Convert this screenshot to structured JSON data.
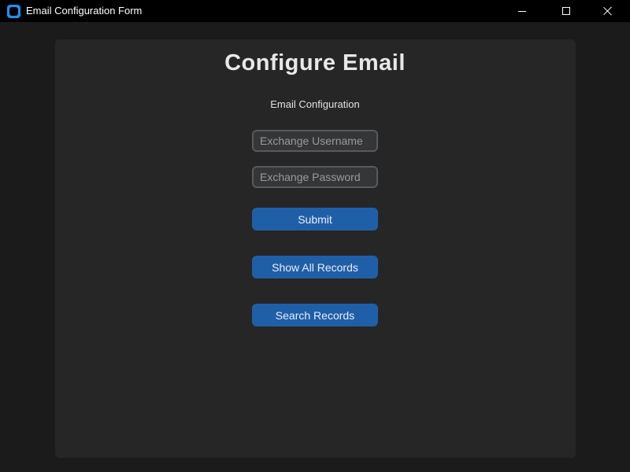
{
  "window": {
    "title": "Email Configuration Form",
    "controls": {
      "minimize": "minimize-icon",
      "maximize": "maximize-icon",
      "close": "close-icon"
    }
  },
  "form": {
    "heading": "Configure Email",
    "subheading": "Email Configuration",
    "username": {
      "value": "",
      "placeholder": "Exchange Username"
    },
    "password": {
      "value": "",
      "placeholder": "Exchange Password"
    },
    "buttons": {
      "submit": "Submit",
      "show_all": "Show All Records",
      "search": "Search Records"
    }
  },
  "colors": {
    "titlebar": "#000000",
    "background": "#1b1b1b",
    "panel": "#262626",
    "button": "#1f5fa8",
    "input_bg": "#343638",
    "input_border": "#565b5e",
    "app_icon": "#1e90ff"
  }
}
